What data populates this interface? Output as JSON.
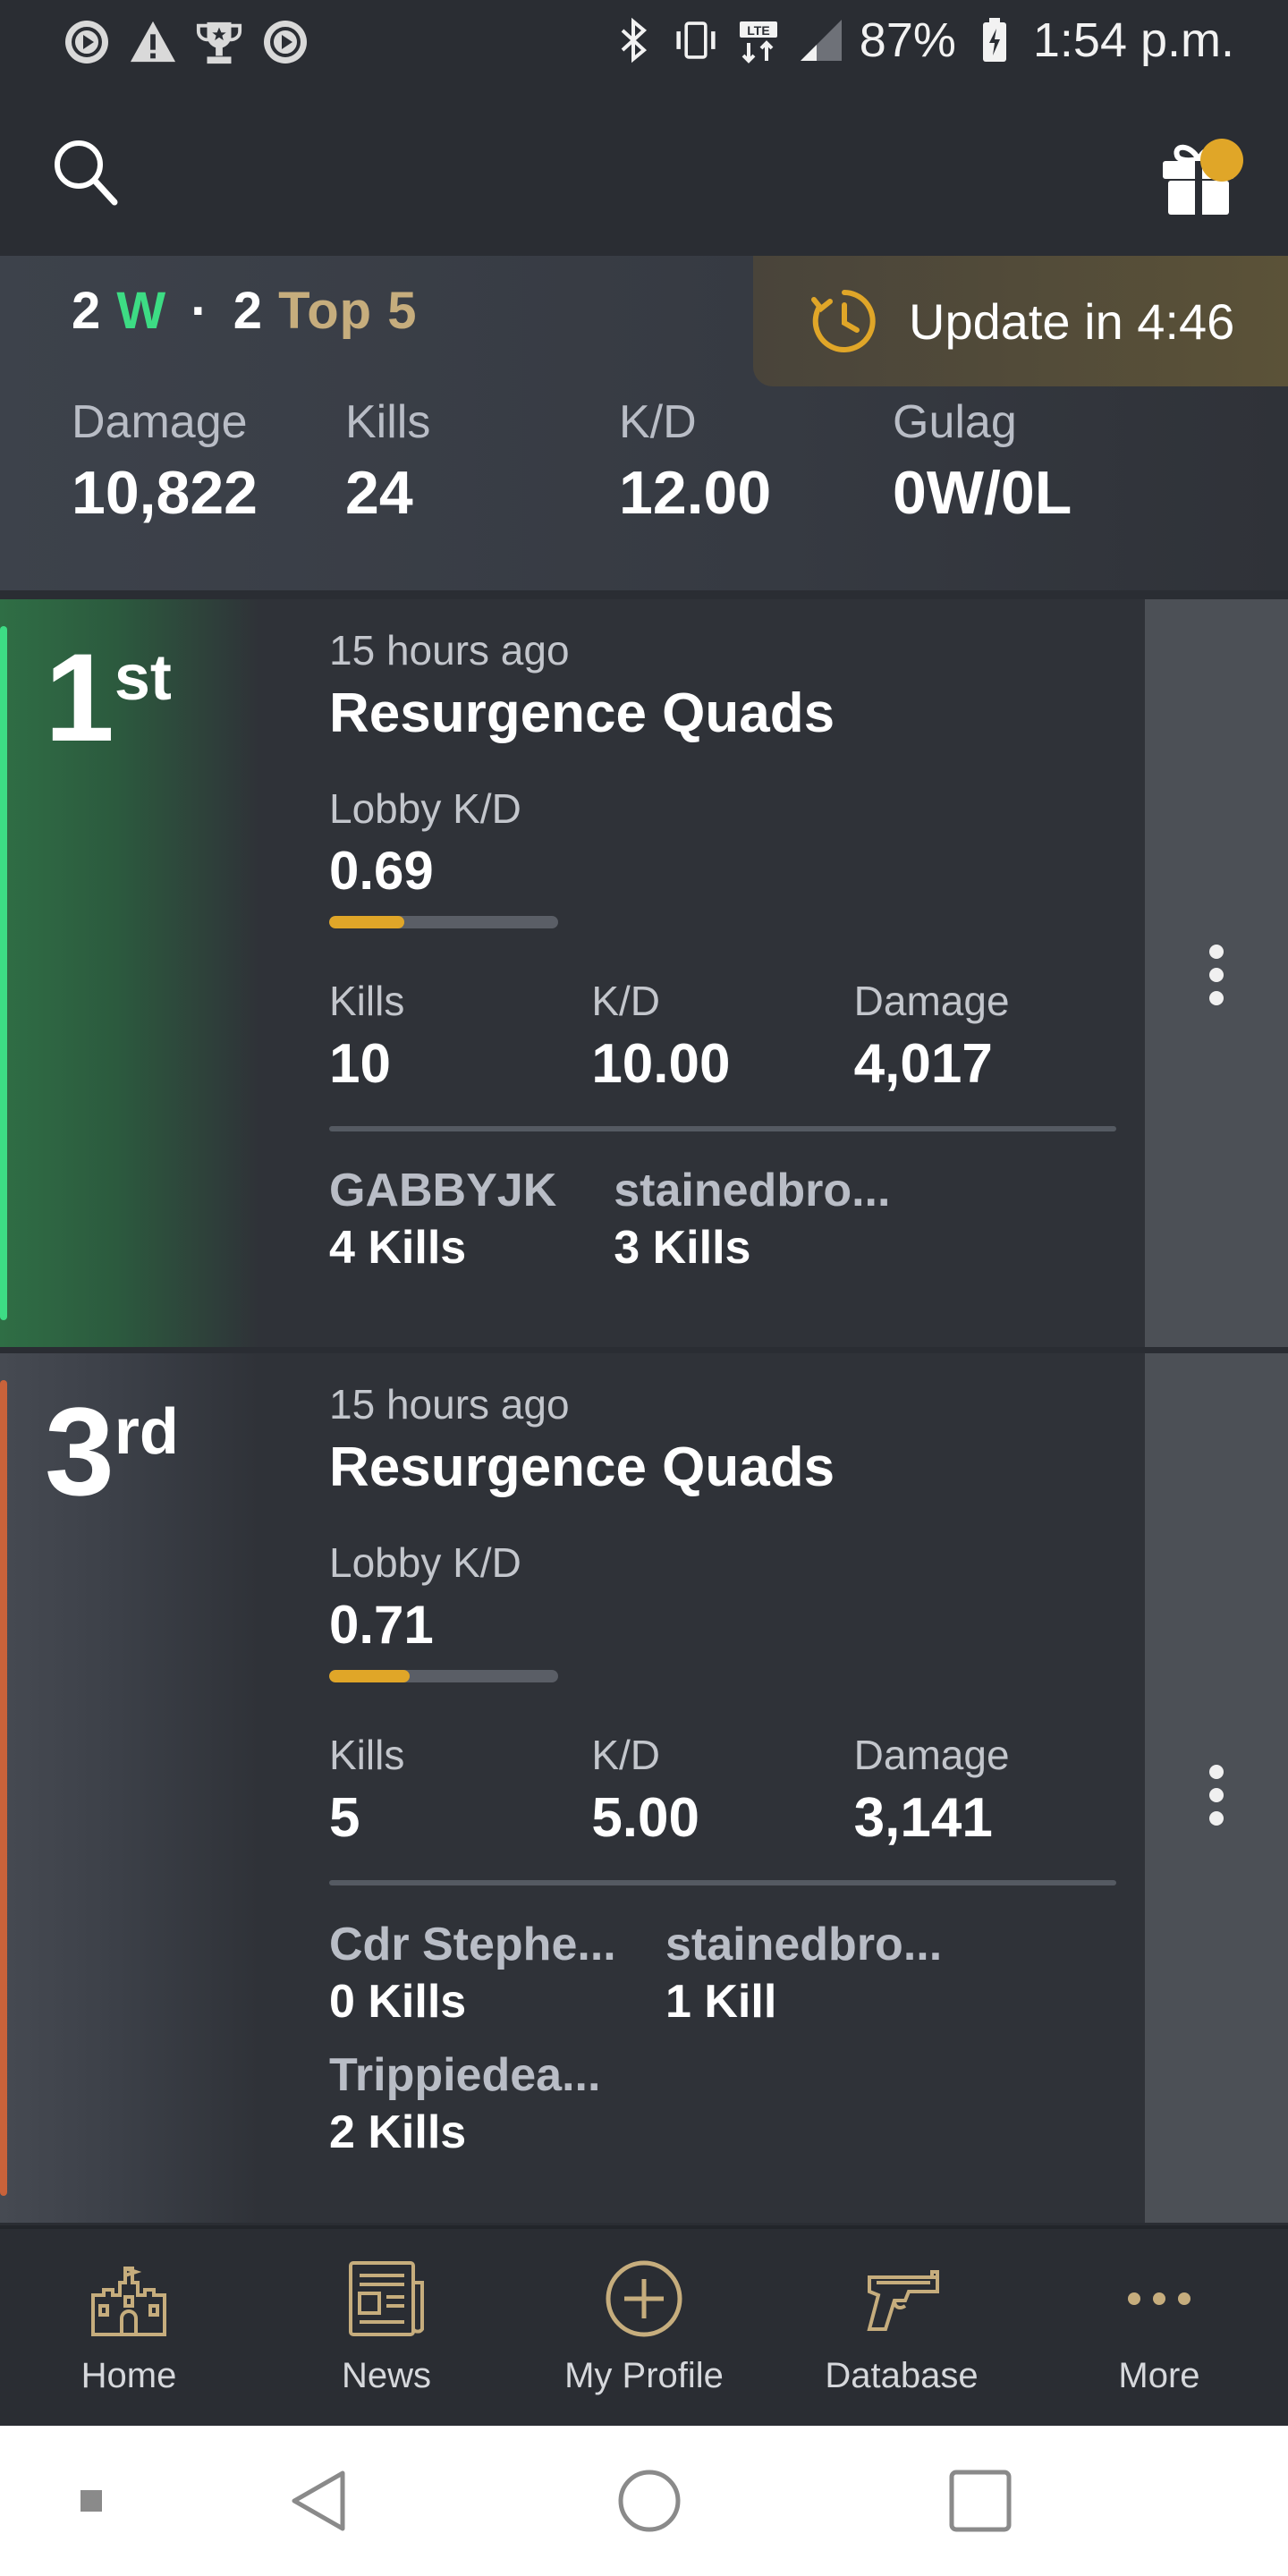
{
  "status_bar": {
    "battery": "87%",
    "time": "1:54 p.m.",
    "left_icons": [
      "play-badge-icon",
      "warning-icon",
      "trophy-icon",
      "play-badge-icon"
    ],
    "right_icons": [
      "bluetooth-icon",
      "vibrate-icon",
      "lte-icon",
      "signal-icon",
      "battery-icon"
    ]
  },
  "app_bar": {
    "icons": [
      "search-icon",
      "gift-icon"
    ],
    "accent": "#e0a628"
  },
  "summary": {
    "wins_count": "2",
    "wins_letter": "W",
    "separator": "·",
    "top5_count": "2",
    "top5_label": "Top 5",
    "update_text": "Update in 4:46",
    "stats": [
      {
        "label": "Damage",
        "value": "10,822"
      },
      {
        "label": "Kills",
        "value": "24"
      },
      {
        "label": "K/D",
        "value": "12.00"
      },
      {
        "label": "Gulag",
        "value": "0W/0L"
      }
    ]
  },
  "matches": [
    {
      "rank_number": "1",
      "rank_suffix": "st",
      "rank_color": "#3ddc84",
      "time": "15 hours ago",
      "mode": "Resurgence Quads",
      "lobby_kd_label": "Lobby K/D",
      "lobby_kd": "0.69",
      "lobby_kd_bar_fraction": 0.33,
      "stats": [
        {
          "label": "Kills",
          "value": "10"
        },
        {
          "label": "K/D",
          "value": "10.00"
        },
        {
          "label": "Damage",
          "value": "4,017"
        }
      ],
      "teammates": [
        {
          "name": "GABBYJK",
          "kills": "4 Kills"
        },
        {
          "name": "stainedbro...",
          "kills": "3 Kills"
        }
      ]
    },
    {
      "rank_number": "3",
      "rank_suffix": "rd",
      "rank_color": "#c8623a",
      "time": "15 hours ago",
      "mode": "Resurgence Quads",
      "lobby_kd_label": "Lobby K/D",
      "lobby_kd": "0.71",
      "lobby_kd_bar_fraction": 0.35,
      "stats": [
        {
          "label": "Kills",
          "value": "5"
        },
        {
          "label": "K/D",
          "value": "5.00"
        },
        {
          "label": "Damage",
          "value": "3,141"
        }
      ],
      "teammates": [
        {
          "name": "Cdr Stephe...",
          "kills": "0 Kills"
        },
        {
          "name": "stainedbro...",
          "kills": "1 Kill"
        },
        {
          "name": "Trippiedea...",
          "kills": "2 Kills"
        }
      ]
    }
  ],
  "bottom_nav": [
    {
      "label": "Home",
      "icon": "castle-icon"
    },
    {
      "label": "News",
      "icon": "newspaper-icon"
    },
    {
      "label": "My Profile",
      "icon": "plus-circle-icon"
    },
    {
      "label": "Database",
      "icon": "gun-icon"
    },
    {
      "label": "More",
      "icon": "more-dots-icon"
    }
  ],
  "system_nav": [
    "recents-dot-icon",
    "back-icon",
    "home-circle-icon",
    "overview-square-icon"
  ]
}
